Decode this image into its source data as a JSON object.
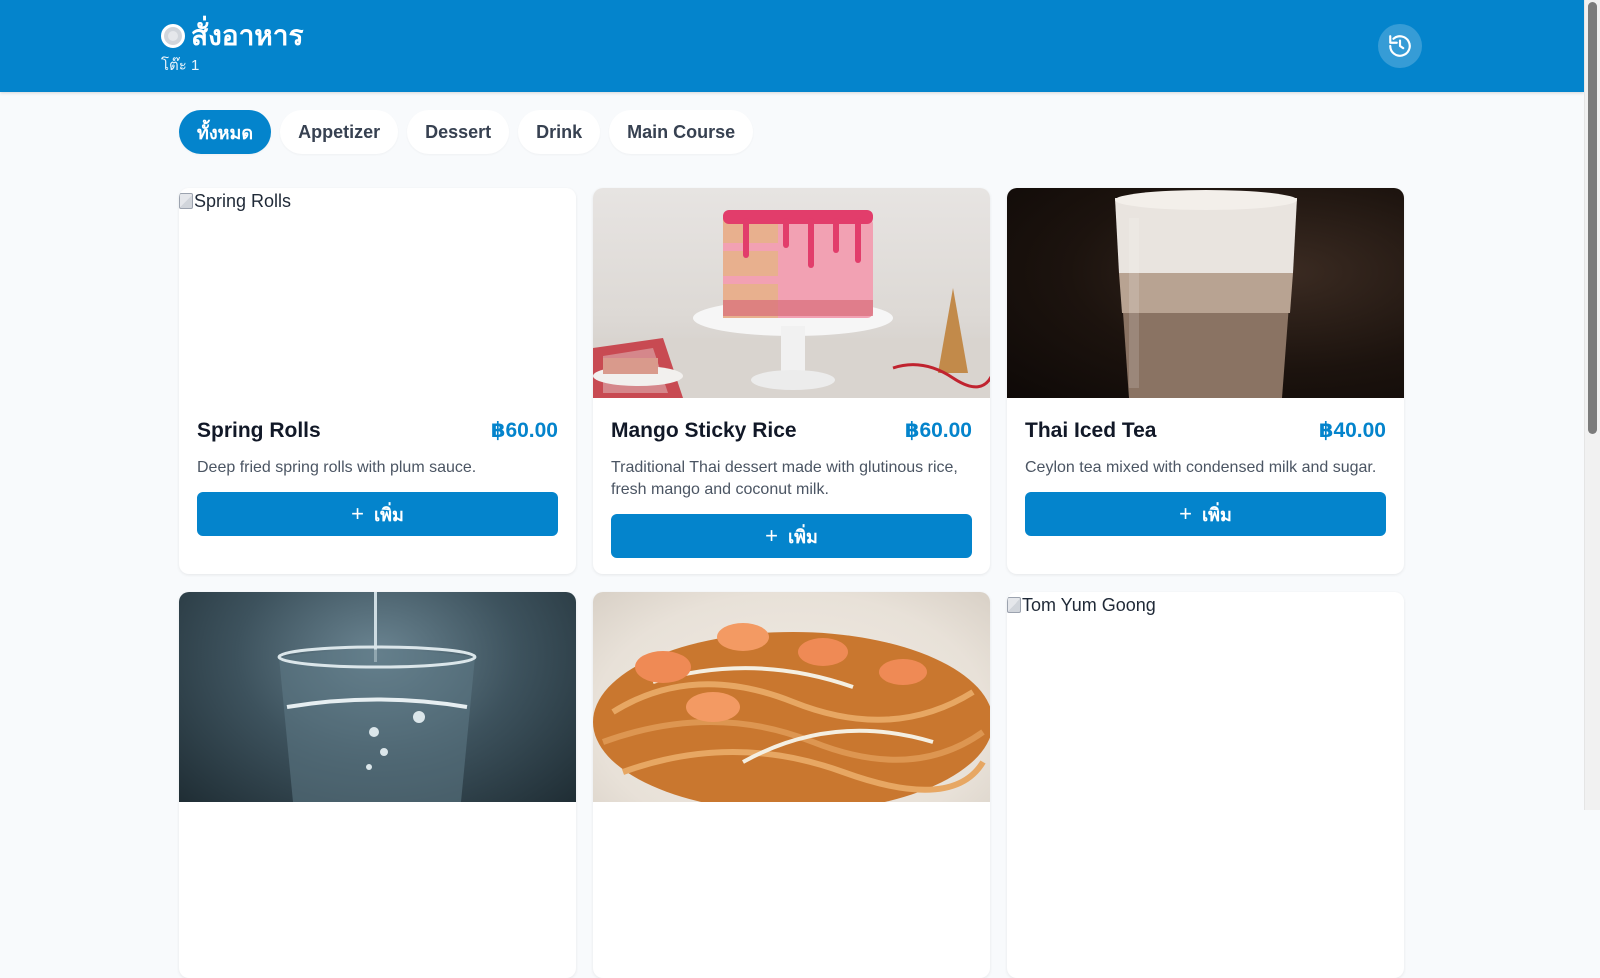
{
  "header": {
    "title": "สั่งอาหาร",
    "icon": "plate-icon",
    "subtitle": "โต๊ะ 1",
    "history_icon": "history-icon",
    "brand_color": "#0484cc"
  },
  "tabs": [
    {
      "label": "ทั้งหมด",
      "active": true
    },
    {
      "label": "Appetizer",
      "active": false
    },
    {
      "label": "Dessert",
      "active": false
    },
    {
      "label": "Drink",
      "active": false
    },
    {
      "label": "Main Course",
      "active": false
    }
  ],
  "menu": [
    {
      "name": "Spring Rolls",
      "price": "฿60.00",
      "description": "Deep fried spring rolls with plum sauce.",
      "image_alt": "Spring Rolls",
      "image_broken": true,
      "add_label": "เพิ่ม"
    },
    {
      "name": "Mango Sticky Rice",
      "price": "฿60.00",
      "description": "Traditional Thai dessert made with glutinous rice, fresh mango and coconut milk.",
      "image_alt": "Mango Sticky Rice",
      "image_broken": false,
      "add_label": "เพิ่ม"
    },
    {
      "name": "Thai Iced Tea",
      "price": "฿40.00",
      "description": "Ceylon tea mixed with condensed milk and sugar.",
      "image_alt": "Thai Iced Tea",
      "image_broken": false,
      "add_label": "เพิ่ม"
    },
    {
      "image_alt": "Water",
      "image_broken": false
    },
    {
      "image_alt": "Pad Thai",
      "image_broken": false
    },
    {
      "image_alt": "Tom Yum Goong",
      "image_broken": true
    }
  ]
}
